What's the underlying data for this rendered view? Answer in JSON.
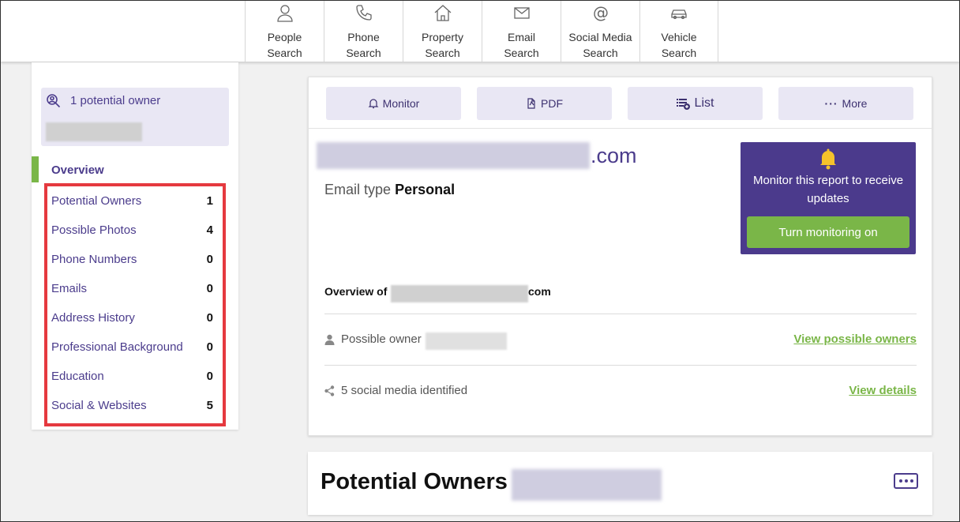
{
  "nav": {
    "tabs": [
      {
        "line1": "People",
        "line2": "Search",
        "icon": "person-icon"
      },
      {
        "line1": "Phone",
        "line2": "Search",
        "icon": "phone-icon"
      },
      {
        "line1": "Property",
        "line2": "Search",
        "icon": "house-icon"
      },
      {
        "line1": "Email",
        "line2": "Search",
        "icon": "envelope-icon"
      },
      {
        "line1": "Social Media",
        "line2": "Search",
        "icon": "at-sign-icon"
      },
      {
        "line1": "Vehicle",
        "line2": "Search",
        "icon": "car-icon"
      }
    ]
  },
  "sidebar": {
    "owner_text": "1 potential owner",
    "overview": "Overview",
    "items": [
      {
        "label": "Potential Owners",
        "count": "1"
      },
      {
        "label": "Possible Photos",
        "count": "4"
      },
      {
        "label": "Phone Numbers",
        "count": "0"
      },
      {
        "label": "Emails",
        "count": "0"
      },
      {
        "label": "Address History",
        "count": "0"
      },
      {
        "label": "Professional Background",
        "count": "0"
      },
      {
        "label": "Education",
        "count": "0"
      },
      {
        "label": "Social & Websites",
        "count": "5"
      }
    ]
  },
  "toolbar": {
    "monitor": "Monitor",
    "pdf": "PDF",
    "list": "List",
    "more": "More"
  },
  "report": {
    "domain_suffix": ".com",
    "email_type_label": "Email type",
    "email_type_value": "Personal",
    "overview_of": "Overview of",
    "overview_suffix": "com",
    "possible_owner": "Possible owner",
    "view_owners": "View possible owners",
    "social_count_text": "5 social media identified",
    "view_details": "View details"
  },
  "monitor_panel": {
    "text": "Monitor this report to receive updates",
    "button": "Turn monitoring on"
  },
  "section2": {
    "title": "Potential Owners"
  },
  "colors": {
    "accent_purple": "#4b3a8c",
    "accent_green": "#7ab648",
    "highlight_red": "#e5393f"
  }
}
